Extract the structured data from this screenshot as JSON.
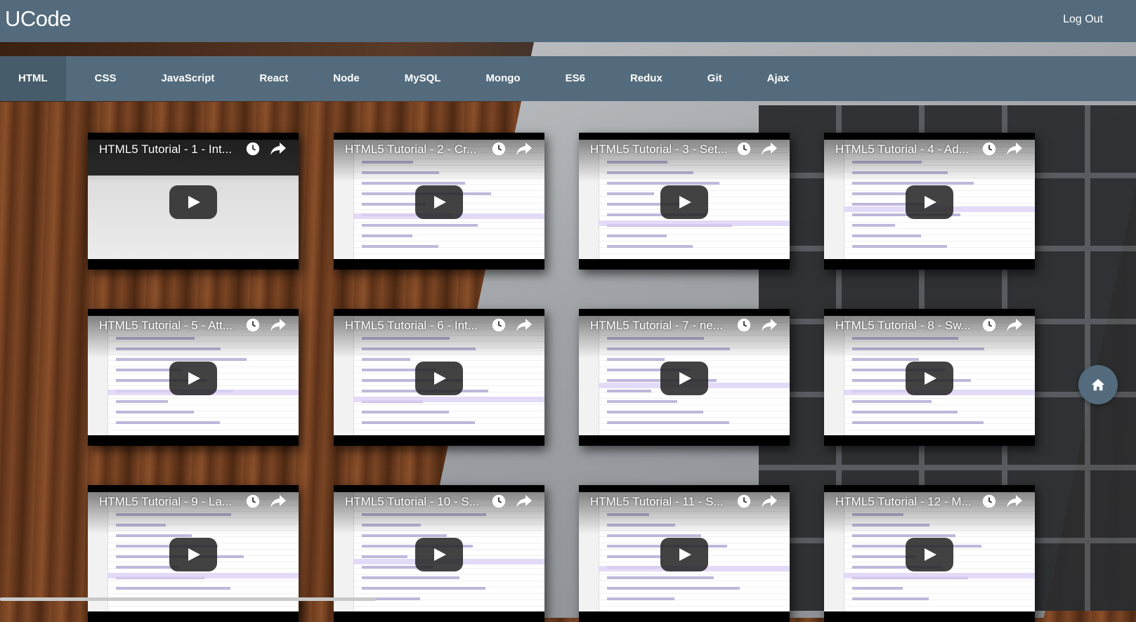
{
  "app": {
    "brand": "UCode",
    "logout_label": "Log Out"
  },
  "nav": {
    "items": [
      {
        "label": "HTML",
        "active": true
      },
      {
        "label": "CSS"
      },
      {
        "label": "JavaScript"
      },
      {
        "label": "React"
      },
      {
        "label": "Node"
      },
      {
        "label": "MySQL"
      },
      {
        "label": "Mongo"
      },
      {
        "label": "ES6"
      },
      {
        "label": "Redux"
      },
      {
        "label": "Git"
      },
      {
        "label": "Ajax"
      }
    ]
  },
  "videos": [
    {
      "title": "HTML5 Tutorial - 1 - Int..."
    },
    {
      "title": "HTML5 Tutorial - 2 - Cr..."
    },
    {
      "title": "HTML5 Tutorial - 3 - Set..."
    },
    {
      "title": "HTML5 Tutorial - 4 - Ad..."
    },
    {
      "title": "HTML5 Tutorial - 5 - Att..."
    },
    {
      "title": "HTML5 Tutorial - 6 - Int..."
    },
    {
      "title": "HTML5 Tutorial - 7 - ne..."
    },
    {
      "title": "HTML5 Tutorial - 8 - Sw..."
    },
    {
      "title": "HTML5 Tutorial - 9 - La..."
    },
    {
      "title": "HTML5 Tutorial - 10 - S..."
    },
    {
      "title": "HTML5 Tutorial - 11 - S..."
    },
    {
      "title": "HTML5 Tutorial - 12 - M..."
    }
  ],
  "icons": {
    "watch_later": "clock-icon",
    "share": "share-arrow-icon",
    "play": "play-icon",
    "home": "home-icon"
  },
  "colors": {
    "header_bg": "#536b7c",
    "nav_active_bg": "#475c6b",
    "text": "#ffffff"
  }
}
